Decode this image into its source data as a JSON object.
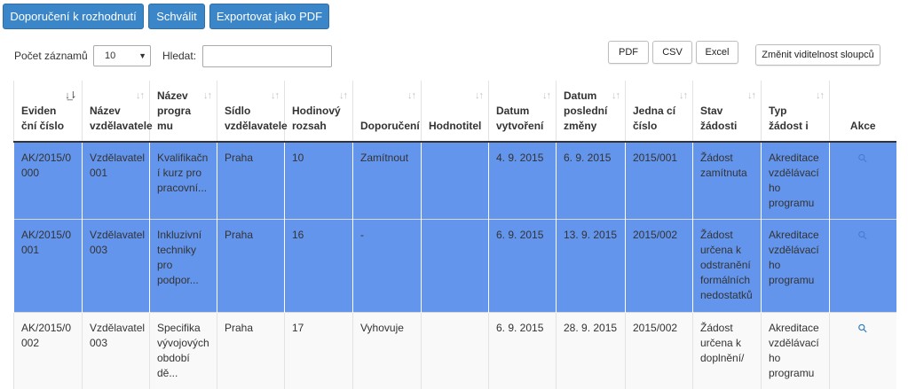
{
  "toolbar": {
    "recommend": "Doporučení k rozhodnutí",
    "approve": "Schválit",
    "export_pdf": "Exportovat jako PDF"
  },
  "controls": {
    "records_label": "Počet záznamů",
    "records_value": "10",
    "search_label": "Hledat:",
    "search_value": ""
  },
  "export_buttons": {
    "pdf": "PDF",
    "csv": "CSV",
    "excel": "Excel",
    "columns": "Změnit viditelnost sloupců"
  },
  "table": {
    "headers": [
      "Eviden ční číslo",
      "Název vzdělavatele",
      "Název progra mu",
      "Sídlo vzdělavatele",
      "Hodinový rozsah",
      "Doporučení",
      "Hodnotitel",
      "Datum vytvoření",
      "Datum poslední změny",
      "Jedna cí číslo",
      "Stav žádosti",
      "Typ žádost i",
      "Akce"
    ],
    "rows": [
      {
        "evid": "AK/2015/0 000",
        "vzdel": "Vzdělavatel 001",
        "program": "Kvalifikačn í kurz pro pracovní...",
        "sidlo": "Praha",
        "hodiny": "10",
        "doporuceni": "Zamítnout",
        "hodnotitel": "",
        "vytvoreni": "4. 9. 2015",
        "zmena": "6. 9. 2015",
        "jednaci": "2015/001",
        "stav": "Žádost zamítnuta",
        "typ": "Akreditace vzdělávací ho programu"
      },
      {
        "evid": "AK/2015/0 001",
        "vzdel": "Vzdělavatel 003",
        "program": "Inkluzivní techniky pro podpor...",
        "sidlo": "Praha",
        "hodiny": "16",
        "doporuceni": "-",
        "hodnotitel": "",
        "vytvoreni": "6. 9. 2015",
        "zmena": "13. 9. 2015",
        "jednaci": "2015/002",
        "stav": "Žádost určena k odstranění formálních nedostatků",
        "typ": "Akreditace vzdělávací ho programu"
      },
      {
        "evid": "AK/2015/0 002",
        "vzdel": "Vzdělavatel 003",
        "program": "Specifika vývojových období dě...",
        "sidlo": "Praha",
        "hodiny": "17",
        "doporuceni": "Vyhovuje",
        "hodnotitel": "",
        "vytvoreni": "6. 9. 2015",
        "zmena": "28. 9. 2015",
        "jednaci": "2015/002",
        "stav": "Žádost určena k doplnění/",
        "typ": "Akreditace vzdělávací ho programu"
      }
    ]
  },
  "colors": {
    "primary_button": "#3a86c8",
    "selected_row": "#6495ed"
  },
  "icons": {
    "sort": "sort-icon",
    "sort_active": "sort-ascending-icon",
    "view": "magnifier-icon"
  }
}
